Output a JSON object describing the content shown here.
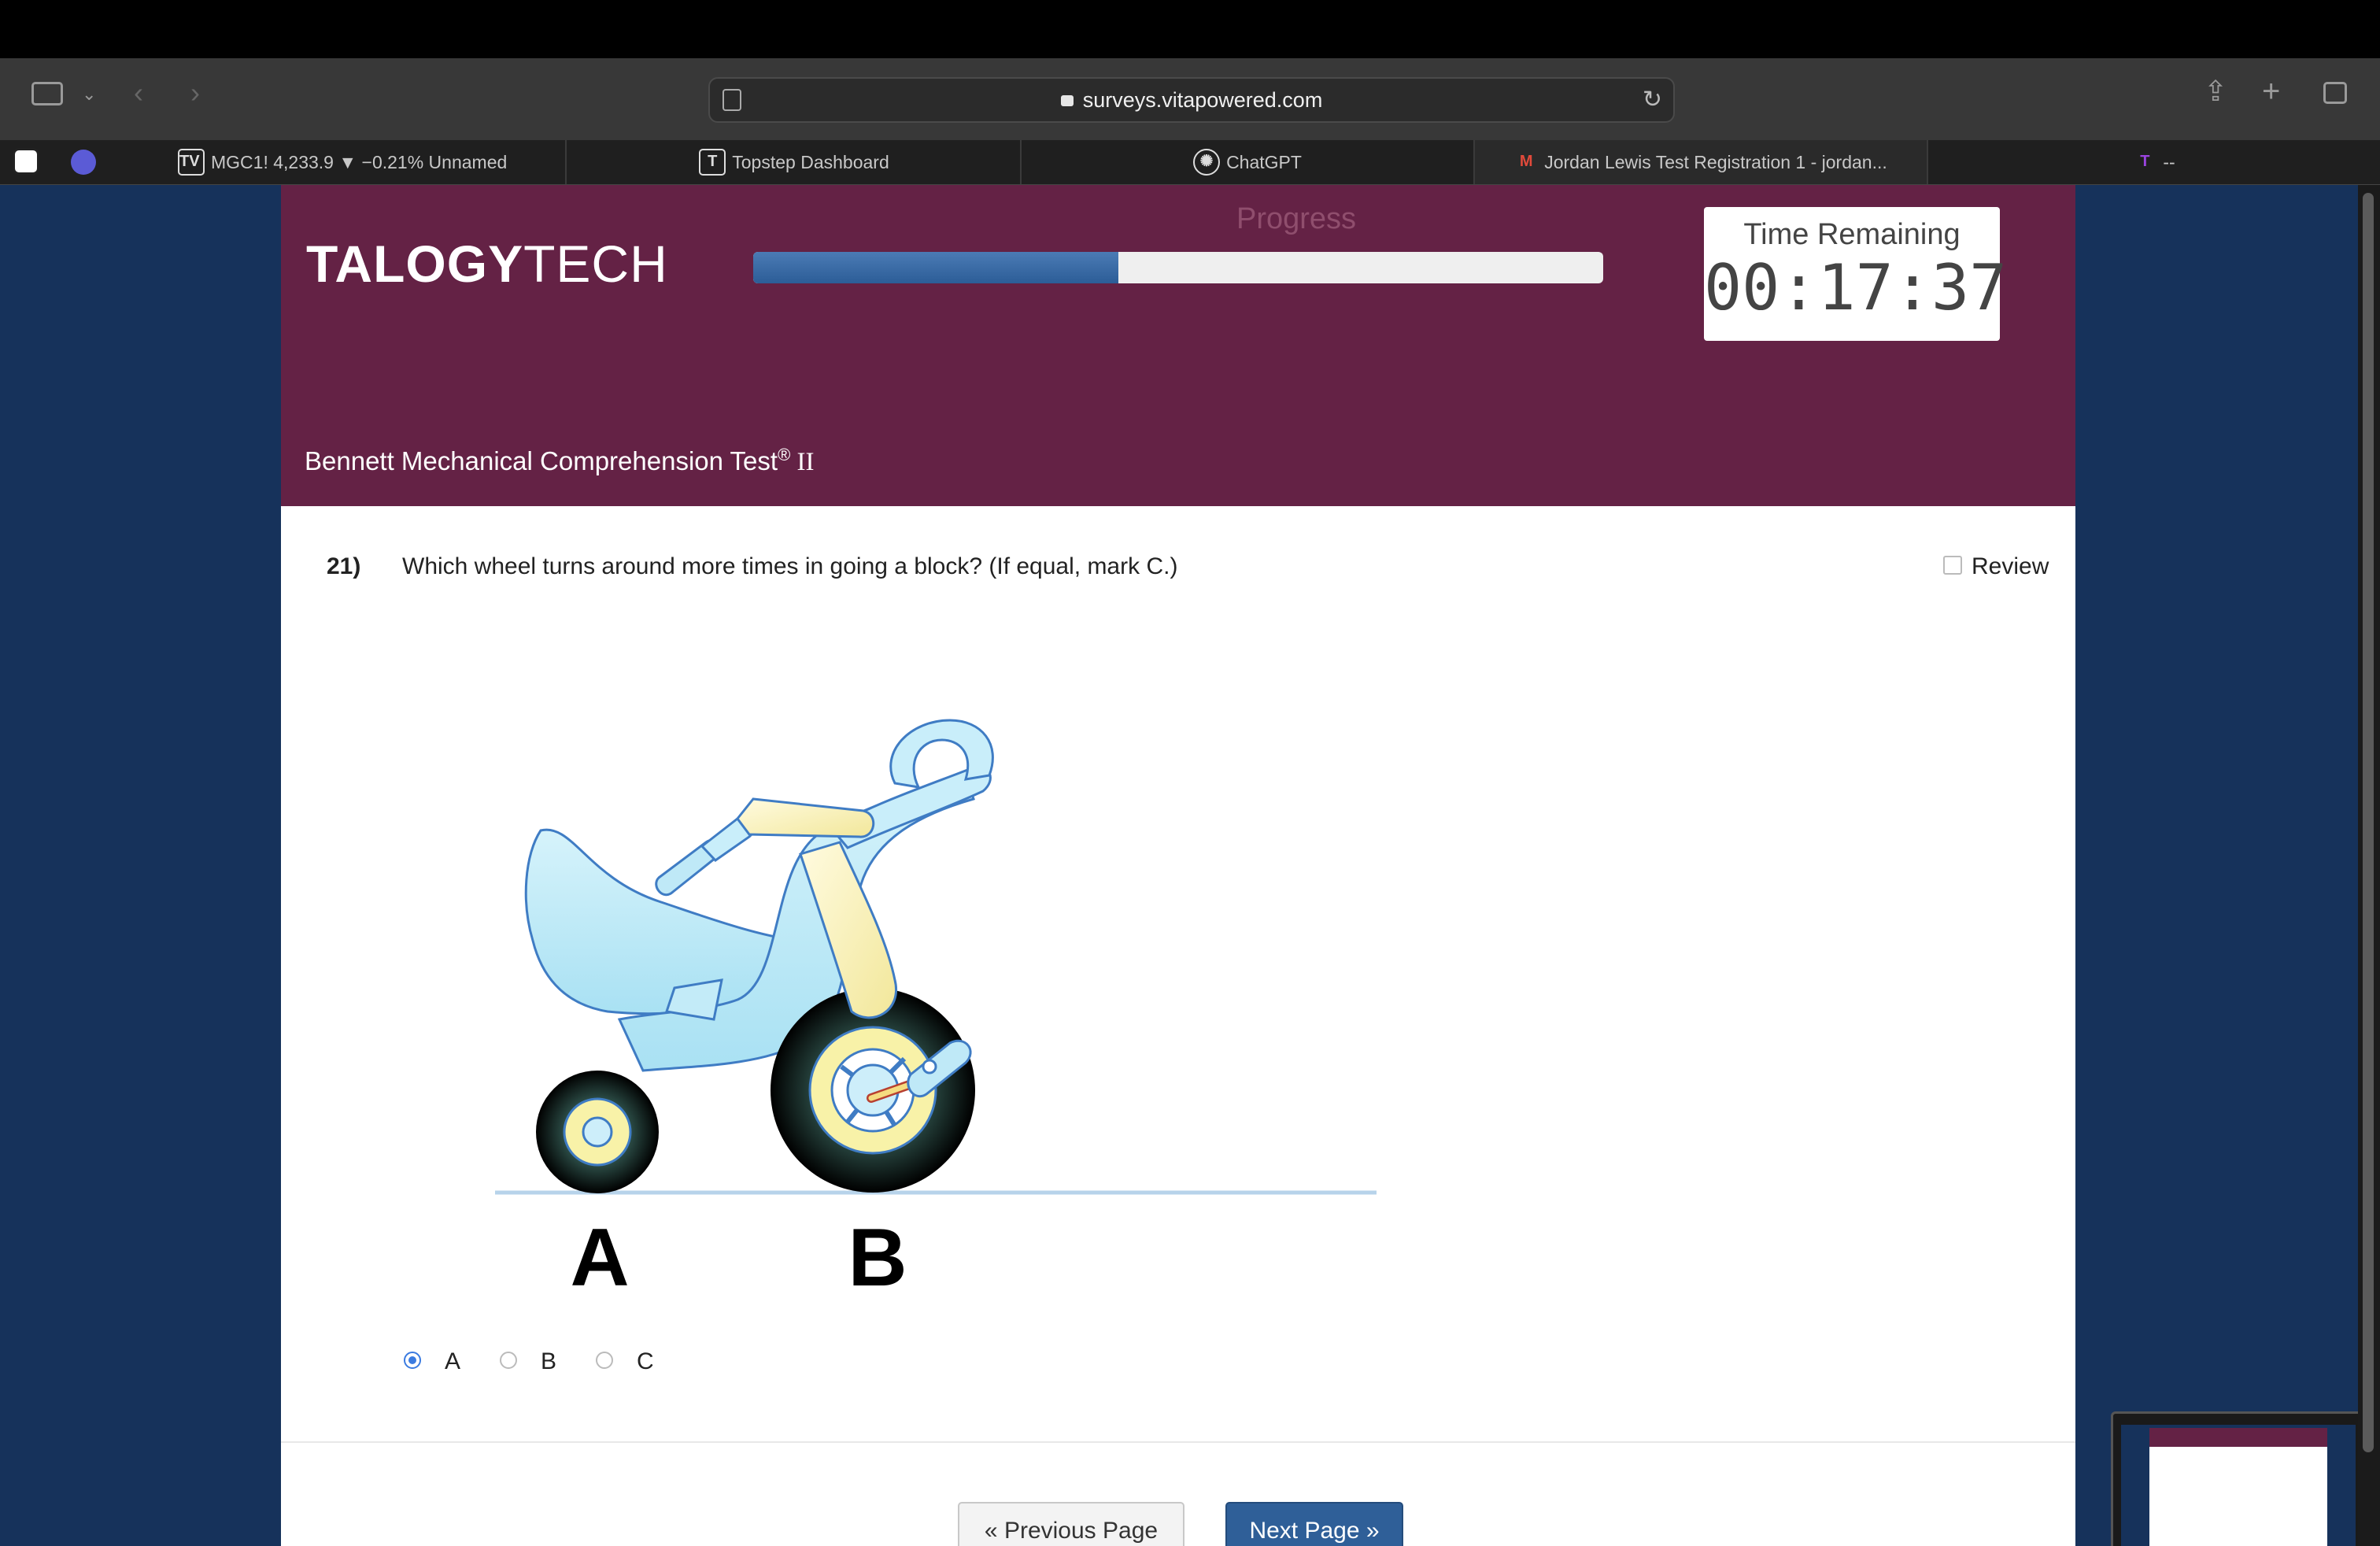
{
  "browser": {
    "url": "surveys.vitapowered.com",
    "tabs": [
      {
        "label": "MGC1! 4,233.9 ▼ −0.21% Unnamed",
        "icon": "tradingview-icon"
      },
      {
        "label": "Topstep Dashboard",
        "icon": "topstep-icon"
      },
      {
        "label": "ChatGPT",
        "icon": "chatgpt-icon"
      },
      {
        "label": "Jordan Lewis Test Registration 1 - jordan...",
        "icon": "gmail-icon"
      },
      {
        "label": "--",
        "icon": "t-icon"
      }
    ],
    "pinned_tabs": [
      "notion-icon",
      "dollar-icon"
    ]
  },
  "header": {
    "logo_bold": "TALOGY",
    "logo_light": "TECH",
    "progress_label": "Progress",
    "progress_fraction": 0.43,
    "timer_label": "Time Remaining",
    "timer_value": "00:17:37",
    "test_title": "Bennett Mechanical Comprehension Test",
    "test_title_mark": "®",
    "test_title_suffix": " II"
  },
  "question": {
    "number": "21)",
    "text": "Which wheel turns around more times in going a block? (If equal, mark C.)",
    "review_label": "Review",
    "figure_labels": [
      "A",
      "B"
    ],
    "options": [
      {
        "label": "A",
        "selected": true
      },
      {
        "label": "B",
        "selected": false
      },
      {
        "label": "C",
        "selected": false
      }
    ]
  },
  "nav": {
    "prev_label": "« Previous Page",
    "next_label": "Next Page »"
  },
  "colors": {
    "banner": "#642245",
    "page_bg": "#16325b",
    "progress": "#2c5d97"
  }
}
